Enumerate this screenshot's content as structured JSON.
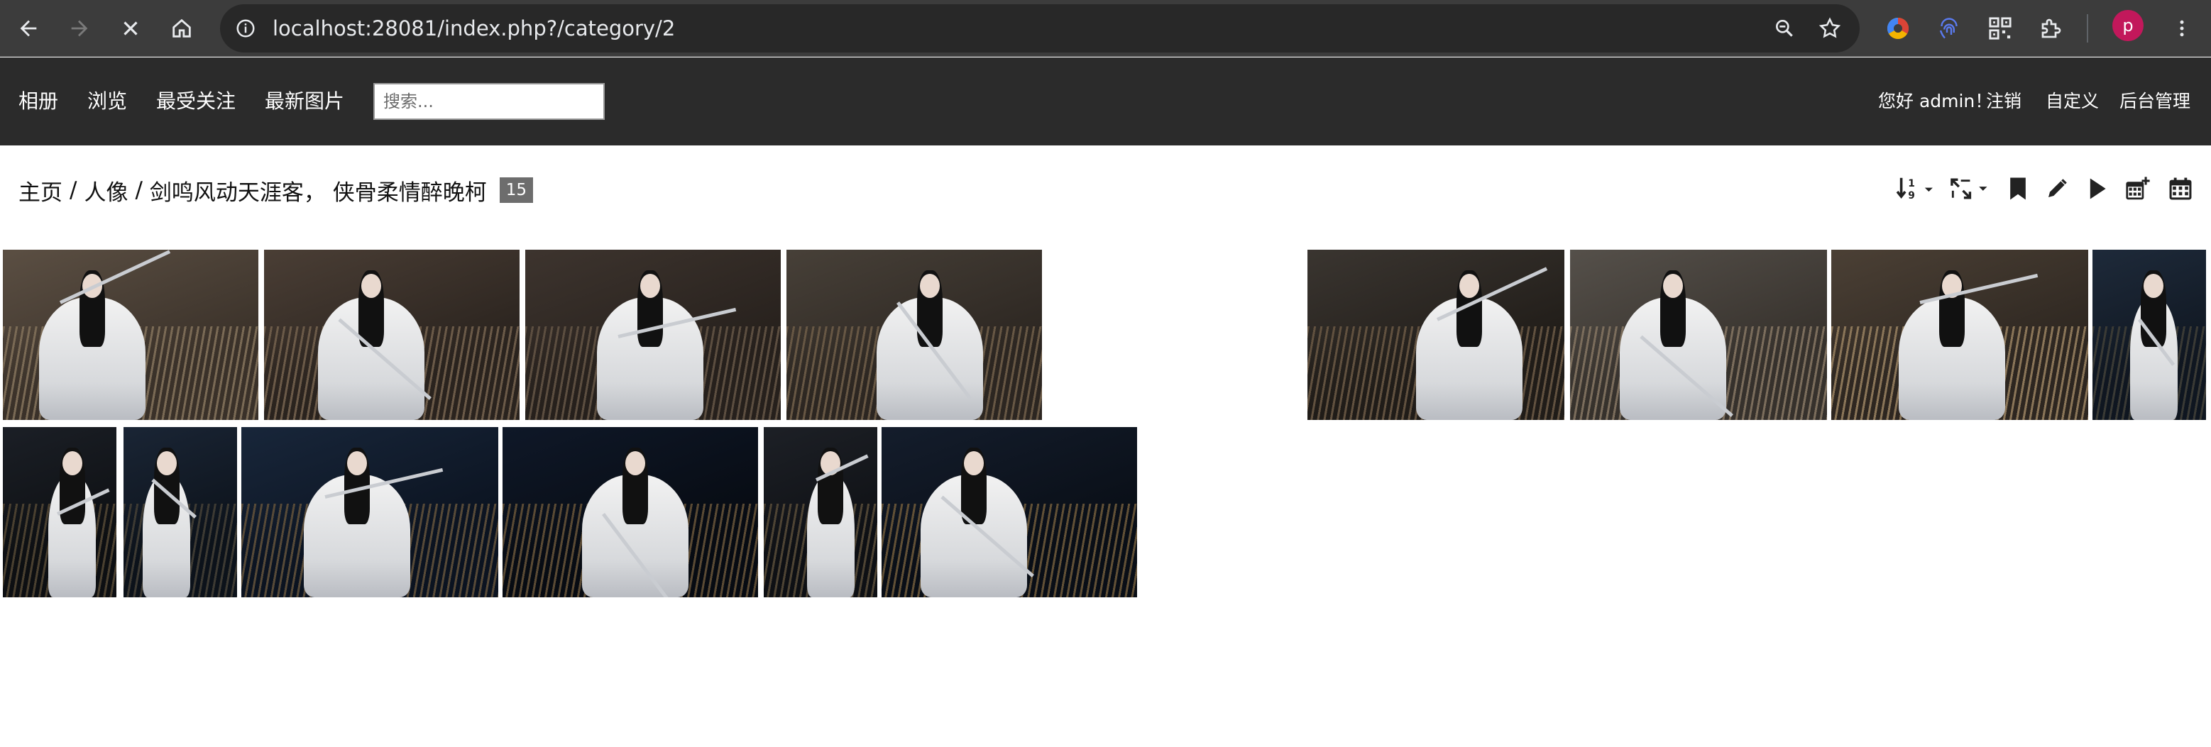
{
  "browser": {
    "url": "localhost:28081/index.php?/category/2",
    "avatar_letter": "p",
    "icons": [
      "back-icon",
      "forward-icon",
      "stop-icon",
      "home-icon",
      "site-info-icon",
      "zoom-icon",
      "bookmark-star-icon",
      "extension-color-icon",
      "extension-fingerprint-icon",
      "extension-qr-icon",
      "extensions-puzzle-icon",
      "kebab-menu-icon"
    ]
  },
  "navbar": {
    "items": [
      "相册",
      "浏览",
      "最受关注",
      "最新图片"
    ],
    "search_placeholder": "搜索...",
    "greeting": "您好 admin！",
    "logout": "注销",
    "customize": "自定义",
    "admin": "后台管理"
  },
  "title": {
    "crumbs": [
      "主页",
      "人像",
      "剑鸣风动天涯客， 侠骨柔情醉晚柯"
    ],
    "separator": "/",
    "count": "15"
  },
  "toolbar": {
    "icons": [
      "sort-order-icon",
      "photo-size-icon",
      "bookmark-icon",
      "edit-icon",
      "slideshow-play-icon",
      "calendar-posted-icon",
      "calendar-created-icon"
    ]
  },
  "thumbnails": {
    "row1": [
      "photo-1",
      "photo-2",
      "photo-3",
      "photo-4",
      "photo-5",
      "photo-6",
      "photo-7",
      "photo-8"
    ],
    "row2": [
      "photo-9",
      "photo-10",
      "photo-11",
      "photo-12",
      "photo-13",
      "photo-14"
    ]
  },
  "colors": {
    "chrome_bg": "#3c3c3c",
    "navbar_bg": "#2b2b2b",
    "badge_bg": "#6d6d6d",
    "text_dark": "#111111"
  }
}
